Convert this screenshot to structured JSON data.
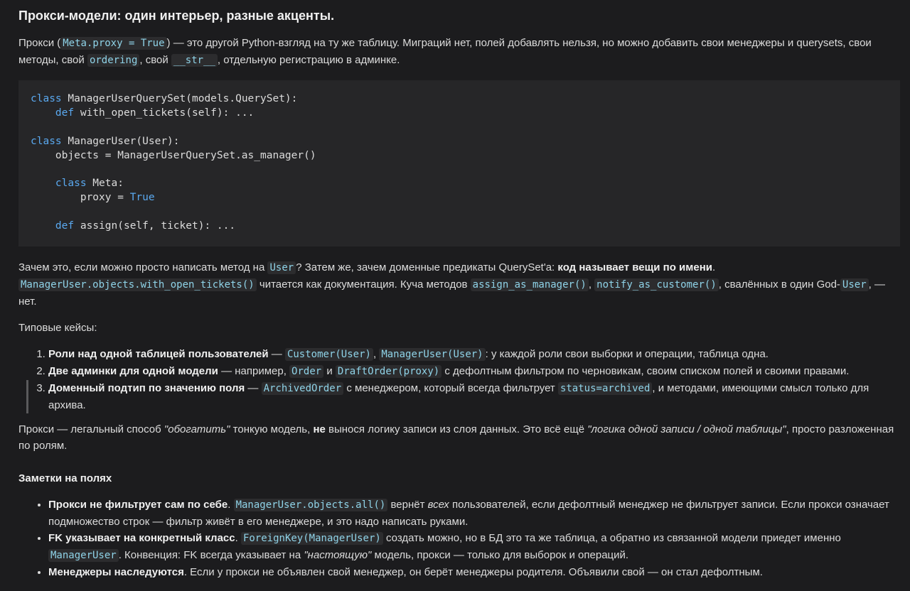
{
  "title": "Прокси-модели: один интерьер, разные акценты.",
  "intro": {
    "t1": "Прокси (",
    "c1": "Meta.proxy = True",
    "t2": ") — это другой Python-взгляд на ту же таблицу. Миграций нет, полей добавлять нельзя, но можно добавить свои менеджеры и querysets, свои методы, свой ",
    "c2": "ordering",
    "t3": ", свой ",
    "c3": "__str__",
    "t4": ", отдельную регистрацию в админке."
  },
  "code": {
    "l1_kw": "class",
    "l1_rest": " ManagerUserQuerySet(models.QuerySet):",
    "l2_indent": "    ",
    "l2_kw": "def",
    "l2_rest": " with_open_tickets(self): ...",
    "l4_kw": "class",
    "l4_rest": " ManagerUser(User):",
    "l5": "    objects = ManagerUserQuerySet.as_manager()",
    "l7_indent": "    ",
    "l7_kw": "class",
    "l7_rest": " Meta:",
    "l8_pre": "        proxy = ",
    "l8_kw": "True",
    "l10_indent": "    ",
    "l10_kw": "def",
    "l10_rest": " assign(self, ticket): ..."
  },
  "why": {
    "t1": "Зачем это, если можно просто написать метод на ",
    "c1": "User",
    "t2": "? Затем же, зачем доменные предикаты QuerySet'а: ",
    "b1": "код называет вещи по имени",
    "t3": ". ",
    "c2": "ManagerUser.objects.with_open_tickets()",
    "t4": " читается как документация. Куча методов ",
    "c3": "assign_as_manager()",
    "t5": ", ",
    "c4": "notify_as_customer()",
    "t6": ", свалённых в один God-",
    "c5": "User",
    "t7": ", — нет."
  },
  "cases_label": "Типовые кейсы:",
  "cases": [
    {
      "b": "Роли над одной таблицей пользователей",
      "t1": " — ",
      "c1": "Customer(User)",
      "t2": ", ",
      "c2": "ManagerUser(User)",
      "t3": ": у каждой роли свои выборки и операции, таблица одна."
    },
    {
      "b": "Две админки для одной модели",
      "t1": " — например, ",
      "c1": "Order",
      "t2": " и ",
      "c2": "DraftOrder(proxy)",
      "t3": " с дефолтным фильтром по черновикам, своим списком полей и своими правами."
    },
    {
      "b": "Доменный подтип по значению поля",
      "t1": " — ",
      "c1": "ArchivedOrder",
      "t2": " с менеджером, который всегда фильтрует ",
      "c2": "status=archived",
      "t3": ", и методами, имеющими смысл только для архива."
    }
  ],
  "summary": {
    "t1": "Прокси — легальный способ ",
    "i1": "\"обогатить\"",
    "t2": " тонкую модель, ",
    "b1": "не",
    "t3": " вынося логику записи из слоя данных. Это всё ещё ",
    "i2": "\"логика одной записи / одной таблицы\"",
    "t4": ", просто разложенная по ролям."
  },
  "notes_title": "Заметки на полях",
  "notes": [
    {
      "b": "Прокси не фильтрует сам по себе",
      "t1": ". ",
      "c1": "ManagerUser.objects.all()",
      "t2": " вернёт ",
      "i1": "всех",
      "t3": " пользователей, если дефолтный менеджер не фильтрует записи. Если прокси означает подмножество строк — фильтр живёт в его менеджере, и это надо написать руками."
    },
    {
      "b": "FK указывает на конкретный класс",
      "t1": ". ",
      "c1": "ForeignKey(ManagerUser)",
      "t2": " создать можно, но в БД это та же таблица, а обратно из связанной модели приедет именно ",
      "c2": "ManagerUser",
      "t3": ". Конвенция: FK всегда указывает на ",
      "i1": "\"настоящую\"",
      "t4": " модель, прокси — только для выборок и операций."
    },
    {
      "b": "Менеджеры наследуются",
      "t1": ". Если у прокси не объявлен свой менеджер, он берёт менеджеры родителя. Объявили свой — он стал дефолтным."
    }
  ]
}
